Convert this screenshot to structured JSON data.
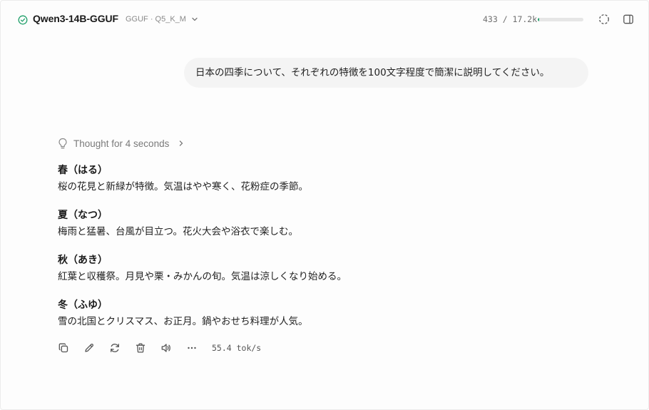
{
  "header": {
    "model_name": "Qwen3-14B-GGUF",
    "model_meta": "GGUF · Q5_K_M",
    "token_count": "433 / 17.2k",
    "token_progress": 0.025,
    "accent_color": "#22a06b"
  },
  "user_message": "日本の四季について、それぞれの特徴を100文字程度で簡潔に説明してください。",
  "thought": {
    "label": "Thought for 4 seconds"
  },
  "answer": {
    "seasons": [
      {
        "title": "春（はる）",
        "desc": "桜の花見と新緑が特徴。気温はやや寒く、花粉症の季節。"
      },
      {
        "title": "夏（なつ）",
        "desc": "梅雨と猛暑、台風が目立つ。花火大会や浴衣で楽しむ。"
      },
      {
        "title": "秋（あき）",
        "desc": "紅葉と収穫祭。月見や栗・みかんの旬。気温は涼しくなり始める。"
      },
      {
        "title": "冬（ふゆ）",
        "desc": "雪の北国とクリスマス、お正月。鍋やおせち料理が人気。"
      }
    ]
  },
  "actions": {
    "icons": [
      "copy-icon",
      "edit-icon",
      "regenerate-icon",
      "delete-icon",
      "speaker-icon",
      "more-icon"
    ],
    "tokens_per_sec": "55.4 tok/s"
  }
}
